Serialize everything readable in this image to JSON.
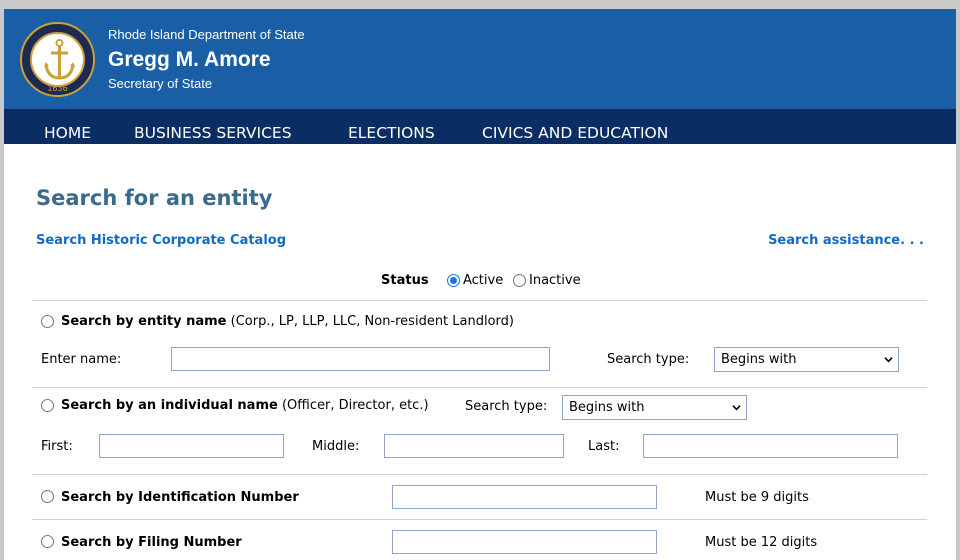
{
  "header": {
    "department": "Rhode Island Department of State",
    "name": "Gregg M. Amore",
    "role": "Secretary of State",
    "seal_year": "1636"
  },
  "nav": {
    "items": [
      "HOME",
      "BUSINESS SERVICES",
      "ELECTIONS",
      "CIVICS AND EDUCATION"
    ]
  },
  "page": {
    "title": "Search for an entity",
    "historic_link": "Search Historic Corporate Catalog",
    "assistance_link": "Search assistance. . ."
  },
  "status": {
    "label": "Status",
    "options": [
      "Active",
      "Inactive"
    ],
    "selected": "Active"
  },
  "entity_search": {
    "title": "Search by entity name",
    "subtitle": "(Corp., LP, LLP, LLC, Non-resident Landlord)",
    "name_label": "Enter name:",
    "name_value": "",
    "search_type_label": "Search type:",
    "search_type_value": "Begins with"
  },
  "individual_search": {
    "title": "Search by an individual name",
    "subtitle": "(Officer, Director, etc.)",
    "search_type_label": "Search type:",
    "search_type_value": "Begins with",
    "first_label": "First:",
    "middle_label": "Middle:",
    "last_label": "Last:"
  },
  "id_search": {
    "title": "Search by Identification Number",
    "note": "Must be 9 digits"
  },
  "filing_search": {
    "title": "Search by Filing Number",
    "note": "Must be 12 digits"
  },
  "colors": {
    "header_blue": "#1a5fa5",
    "nav_navy": "#0a2e64",
    "title_color": "#3a6a8c",
    "link_color": "#1369c4",
    "seal_gold": "#caa23a"
  }
}
